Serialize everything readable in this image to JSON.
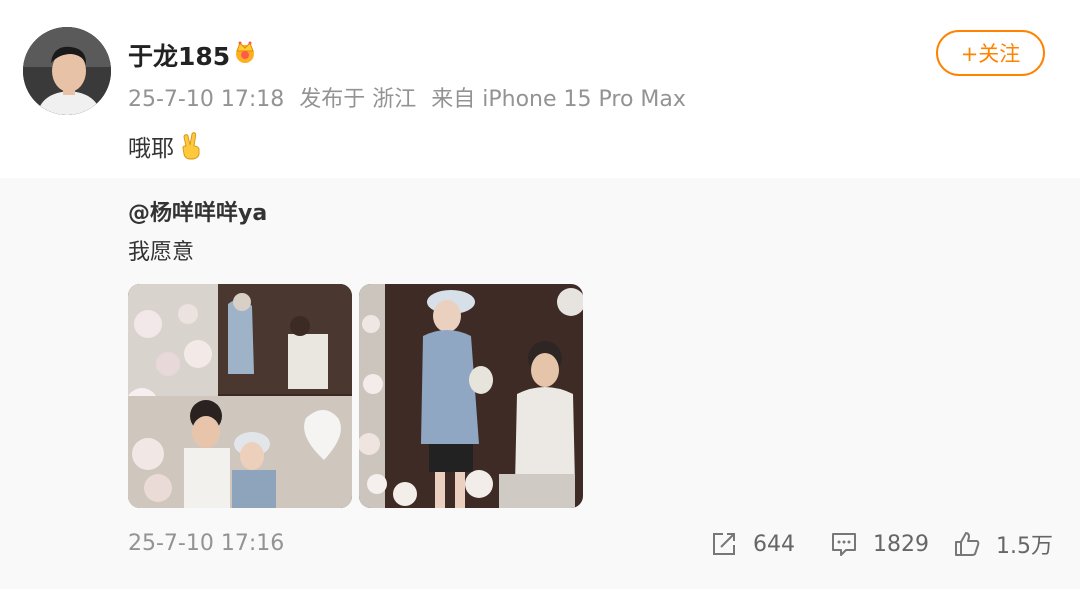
{
  "post": {
    "username": "于龙185",
    "meta": {
      "date": "25-7-10 17:18",
      "published_at": "发布于 浙江",
      "source": "来自 iPhone 15 Pro Max"
    },
    "follow_label": "+关注",
    "text": "哦耶"
  },
  "repost": {
    "author": "@杨咩咩咩ya",
    "text": "我愿意",
    "time": "25-7-10 17:16",
    "stats": {
      "shares": "644",
      "comments": "1829",
      "likes": "1.5万"
    }
  },
  "icons": {
    "verified": "crown-badge-icon",
    "text_emoji": "victory-hand-icon",
    "share": "share-icon",
    "comment": "comment-icon",
    "like": "thumbs-up-icon"
  },
  "colors": {
    "accent": "#ff8200",
    "meta_text": "#939393",
    "repost_background": "#f9f9f9"
  }
}
